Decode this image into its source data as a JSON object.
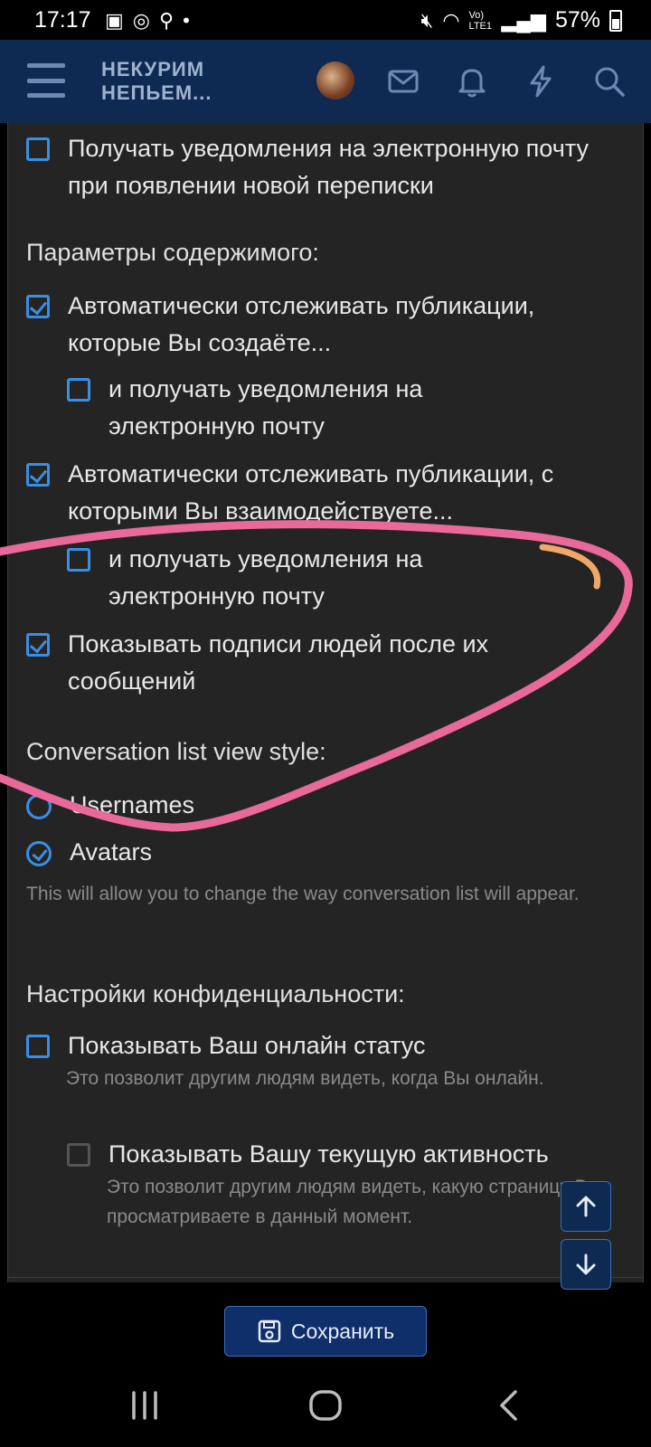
{
  "status_bar": {
    "time": "17:17",
    "battery": "57%",
    "network": "Vo) LTE1"
  },
  "header": {
    "logo_line1": "НЕКУРИМ",
    "logo_line2": "НЕПЬЕМ...",
    "icons": [
      "menu-icon",
      "avatar",
      "mail-icon",
      "bell-icon",
      "bolt-icon",
      "search-icon"
    ]
  },
  "content": {
    "email_new_conversation": {
      "label": "Получать уведомления на электронную почту при появлении новой переписки",
      "checked": false
    },
    "content_params_title": "Параметры содержимого:",
    "watch_created": {
      "label": "Автоматически отслеживать публикации, которые Вы создаёте...",
      "checked": true
    },
    "watch_created_email": {
      "label": "и получать уведомления на электронную почту",
      "checked": false
    },
    "watch_interacted": {
      "label": "Автоматически отслеживать публикации, с которыми Вы взаимодействуете...",
      "checked": true
    },
    "watch_interacted_email": {
      "label": "и получать уведомления на электронную почту",
      "checked": false
    },
    "show_signatures": {
      "label": "Показывать подписи людей после их сообщений",
      "checked": true
    },
    "conv_style_title": "Conversation list view style:",
    "conv_style_options": [
      {
        "label": "Usernames",
        "selected": false
      },
      {
        "label": "Avatars",
        "selected": true
      }
    ],
    "conv_style_hint": "This will allow you to change the way conversation list will appear.",
    "privacy_title": "Настройки конфиденциальности:",
    "show_online": {
      "label": "Показывать Ваш онлайн статус",
      "checked": false
    },
    "show_online_hint": "Это позволит другим людям видеть, когда Вы онлайн.",
    "show_activity": {
      "label": "Показывать Вашу текущую активность",
      "checked": false
    },
    "show_activity_hint": "Это позволит другим людям видеть, какую страницу Вы просматриваете в данный момент."
  },
  "save_label": "Сохранить",
  "colors": {
    "accent": "#3b8ee6",
    "header_bg": "#0f2a52",
    "content_bg": "#242424",
    "scribble": "#e8699a"
  }
}
